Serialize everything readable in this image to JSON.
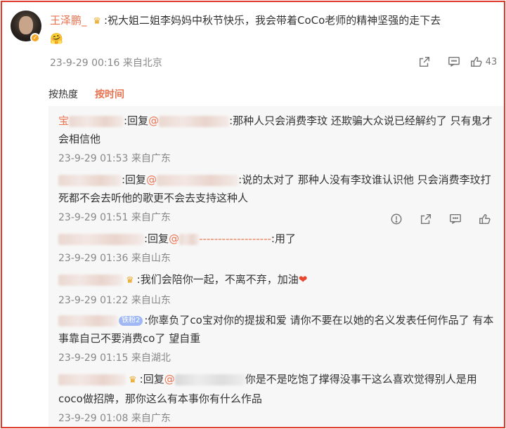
{
  "top_comment": {
    "username": "王泽鹏_",
    "text": ":祝大姐二姐李妈妈中秋节快乐，我会带着CoCo老师的精神坚强的走下去",
    "time": "23-9-29 00:16 来自北京",
    "like_count": "43"
  },
  "sort": {
    "hot": "按热度",
    "time": "按时间"
  },
  "replies": [
    {
      "user_prefix": "宝",
      "text1": ":回复",
      "mention": "@",
      "text2": ":那种人只会消费李玟 还欺骗大众说已经解约了 只有鬼才会相信他",
      "meta": "23-9-29 01:53 来自广东"
    },
    {
      "user_prefix": "",
      "text1": ":回复",
      "mention": "@",
      "text2": ":说的太对了 那种人没有李玟谁认识他 只会消费李玟打死都不会去听他的歌更不会去支持这种人",
      "meta": "23-9-29 01:51 来自广东"
    },
    {
      "user_prefix": "",
      "text1": ":回复",
      "mention": "@",
      "mention_tail": "-------------------",
      "text2": ":用了",
      "meta": "23-9-29 01:36 来自山东"
    },
    {
      "user_prefix": "",
      "text1": ":我们会陪你一起，不离不弃，加油",
      "heart": "❤",
      "meta": "23-9-29 01:22 来自山东"
    },
    {
      "user_prefix": "",
      "badge": "铁粉2",
      "text1": ":你辜负了co宝对你的提拔和爱 请你不要在以她的名义发表任何作品了 有本事靠自己不要消费co了 望自重",
      "meta": "23-9-29 01:15 来自湖北"
    },
    {
      "user_prefix": "",
      "text1": ":回复",
      "mention": "@",
      "text2": "你是不是吃饱了撑得没事干这么喜欢觉得别人是用coco做招牌，那你这么有本事你有什么作品",
      "meta": "23-9-29 01:08 来自广东"
    }
  ],
  "icons": {
    "share": "share-icon",
    "comment": "comment-icon",
    "like": "thumb-up-icon",
    "report": "report-icon"
  },
  "colors": {
    "accent": "#eb7350",
    "border": "#e03a2c",
    "reply_bg": "#f7f7f7",
    "meta": "#888888"
  }
}
